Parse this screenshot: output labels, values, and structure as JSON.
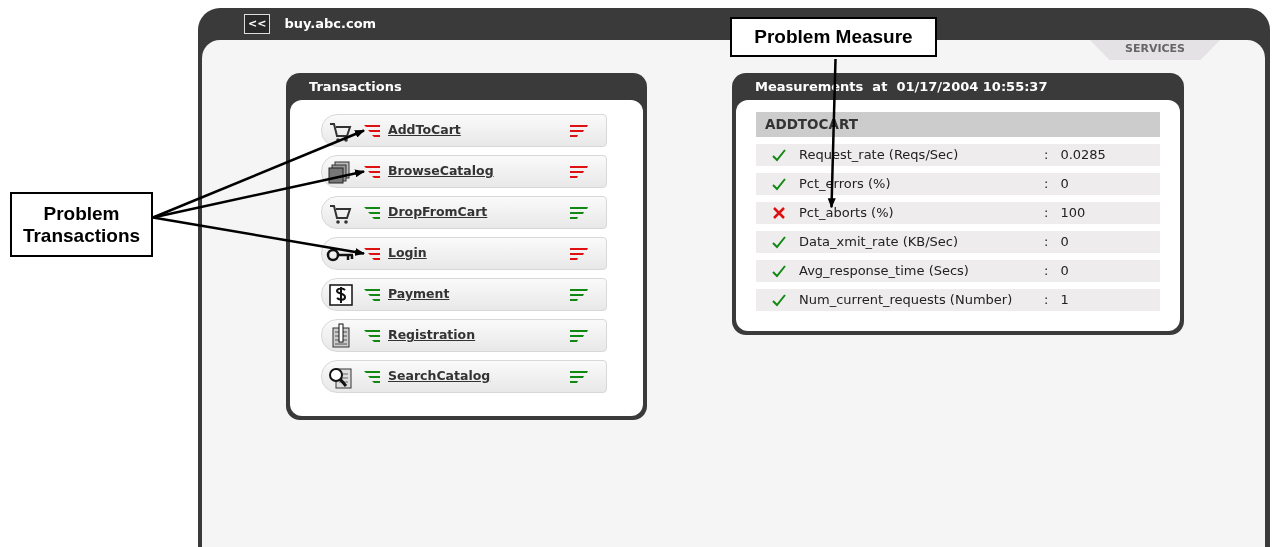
{
  "header": {
    "back_button": "<<",
    "site": "buy.abc.com",
    "tab": "SERVICES"
  },
  "transactions": {
    "title": "Transactions",
    "items": [
      {
        "name": "AddToCart",
        "kind": "cart",
        "problem": true,
        "flagged": true
      },
      {
        "name": "BrowseCatalog",
        "kind": "pages",
        "problem": true,
        "flagged": true
      },
      {
        "name": "DropFromCart",
        "kind": "cart",
        "problem": false,
        "flagged": false
      },
      {
        "name": "Login",
        "kind": "key",
        "problem": true,
        "flagged": true
      },
      {
        "name": "Payment",
        "kind": "dollar",
        "problem": false,
        "flagged": false
      },
      {
        "name": "Registration",
        "kind": "form",
        "problem": false,
        "flagged": false
      },
      {
        "name": "SearchCatalog",
        "kind": "search",
        "problem": false,
        "flagged": false
      }
    ]
  },
  "measurements": {
    "title": "Measurements  at  01/17/2004 10:55:37",
    "section": "ADDTOCART",
    "rows": [
      {
        "name": "Request_rate (Reqs/Sec)",
        "separator": ":",
        "value": "0.0285",
        "passed": true,
        "flagged": false
      },
      {
        "name": "Pct_errors (%)",
        "separator": ":",
        "value": "0",
        "passed": true,
        "flagged": false
      },
      {
        "name": "Pct_aborts (%)",
        "separator": ":",
        "value": "100",
        "passed": false,
        "flagged": true
      },
      {
        "name": "Data_xmit_rate (KB/Sec)",
        "separator": ":",
        "value": "0",
        "passed": true,
        "flagged": false
      },
      {
        "name": "Avg_response_time (Secs)",
        "separator": ":",
        "value": "0",
        "passed": true,
        "flagged": false
      },
      {
        "name": "Num_current_requests (Number)",
        "separator": ":",
        "value": "1",
        "passed": true,
        "flagged": false
      }
    ]
  },
  "annotations": [
    {
      "text": "Problem Transactions",
      "kind": "transactions"
    },
    {
      "text": "Problem Measure",
      "kind": "measurements"
    }
  ]
}
